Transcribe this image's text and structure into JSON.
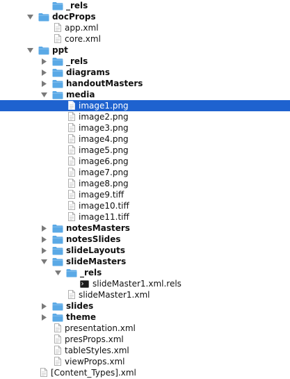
{
  "colors": {
    "selection": "#1e62cf",
    "folder": "#5aa9e6",
    "disclosure": "#7a7a7a"
  },
  "tree": {
    "rows": [
      {
        "label": "_rels",
        "kind": "folder",
        "depth": 1,
        "expanded": false,
        "has_children": false,
        "bold": true
      },
      {
        "label": "docProps",
        "kind": "folder",
        "depth": 0,
        "expanded": true,
        "has_children": true,
        "bold": true
      },
      {
        "label": "app.xml",
        "kind": "file",
        "depth": 1,
        "bold": false
      },
      {
        "label": "core.xml",
        "kind": "file",
        "depth": 1,
        "bold": false
      },
      {
        "label": "ppt",
        "kind": "folder",
        "depth": 0,
        "expanded": true,
        "has_children": true,
        "bold": true
      },
      {
        "label": "_rels",
        "kind": "folder",
        "depth": 1,
        "expanded": false,
        "has_children": true,
        "bold": true
      },
      {
        "label": "diagrams",
        "kind": "folder",
        "depth": 1,
        "expanded": false,
        "has_children": true,
        "bold": true
      },
      {
        "label": "handoutMasters",
        "kind": "folder",
        "depth": 1,
        "expanded": false,
        "has_children": true,
        "bold": true
      },
      {
        "label": "media",
        "kind": "folder",
        "depth": 1,
        "expanded": true,
        "has_children": true,
        "bold": true
      },
      {
        "label": "image1.png",
        "kind": "file",
        "depth": 2,
        "bold": false,
        "selected": true
      },
      {
        "label": "image2.png",
        "kind": "file",
        "depth": 2,
        "bold": false
      },
      {
        "label": "image3.png",
        "kind": "file",
        "depth": 2,
        "bold": false
      },
      {
        "label": "image4.png",
        "kind": "file",
        "depth": 2,
        "bold": false
      },
      {
        "label": "image5.png",
        "kind": "file",
        "depth": 2,
        "bold": false
      },
      {
        "label": "image6.png",
        "kind": "file",
        "depth": 2,
        "bold": false
      },
      {
        "label": "image7.png",
        "kind": "file",
        "depth": 2,
        "bold": false
      },
      {
        "label": "image8.png",
        "kind": "file",
        "depth": 2,
        "bold": false
      },
      {
        "label": "image9.tiff",
        "kind": "file",
        "depth": 2,
        "bold": false
      },
      {
        "label": "image10.tiff",
        "kind": "file",
        "depth": 2,
        "bold": false
      },
      {
        "label": "image11.tiff",
        "kind": "file",
        "depth": 2,
        "bold": false
      },
      {
        "label": "notesMasters",
        "kind": "folder",
        "depth": 1,
        "expanded": false,
        "has_children": true,
        "bold": true
      },
      {
        "label": "notesSlides",
        "kind": "folder",
        "depth": 1,
        "expanded": false,
        "has_children": true,
        "bold": true
      },
      {
        "label": "slideLayouts",
        "kind": "folder",
        "depth": 1,
        "expanded": false,
        "has_children": true,
        "bold": true
      },
      {
        "label": "slideMasters",
        "kind": "folder",
        "depth": 1,
        "expanded": true,
        "has_children": true,
        "bold": true
      },
      {
        "label": "_rels",
        "kind": "folder",
        "depth": 2,
        "expanded": true,
        "has_children": true,
        "bold": true
      },
      {
        "label": "slideMaster1.xml.rels",
        "kind": "terminal",
        "depth": 3,
        "bold": false
      },
      {
        "label": "slideMaster1.xml",
        "kind": "file",
        "depth": 2,
        "bold": false
      },
      {
        "label": "slides",
        "kind": "folder",
        "depth": 1,
        "expanded": false,
        "has_children": true,
        "bold": true
      },
      {
        "label": "theme",
        "kind": "folder",
        "depth": 1,
        "expanded": false,
        "has_children": true,
        "bold": true
      },
      {
        "label": "presentation.xml",
        "kind": "file",
        "depth": 1,
        "bold": false
      },
      {
        "label": "presProps.xml",
        "kind": "file",
        "depth": 1,
        "bold": false
      },
      {
        "label": "tableStyles.xml",
        "kind": "file",
        "depth": 1,
        "bold": false
      },
      {
        "label": "viewProps.xml",
        "kind": "file",
        "depth": 1,
        "bold": false
      },
      {
        "label": "[Content_Types].xml",
        "kind": "file",
        "depth": 0,
        "bold": false
      }
    ]
  }
}
